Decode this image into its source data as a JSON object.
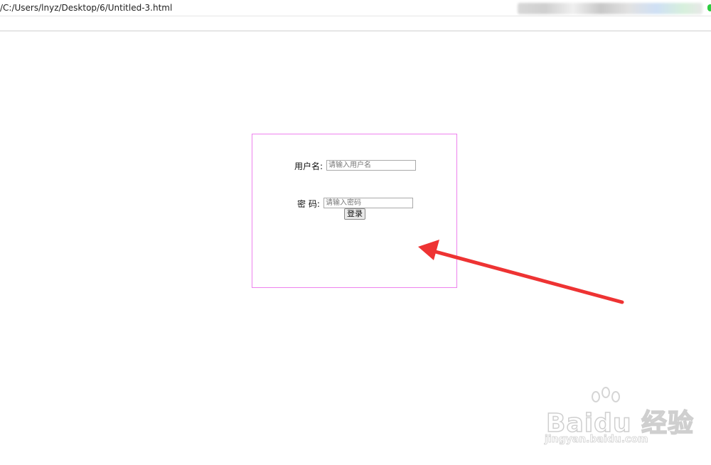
{
  "browser": {
    "url": "/C:/Users/lnyz/Desktop/6/Untitled-3.html"
  },
  "login_form": {
    "username_label": "用户名:",
    "username_placeholder": "请输入用户名",
    "password_label": "密 码:",
    "password_placeholder": "请输入密码",
    "login_button": "登录",
    "border_color": "#ee82ee"
  },
  "annotation": {
    "arrow_color": "#ee3333",
    "arrow_icon": "red-arrow-icon"
  },
  "watermark": {
    "brand": "Baidu 经验",
    "url": "jingyan.baidu.com"
  }
}
